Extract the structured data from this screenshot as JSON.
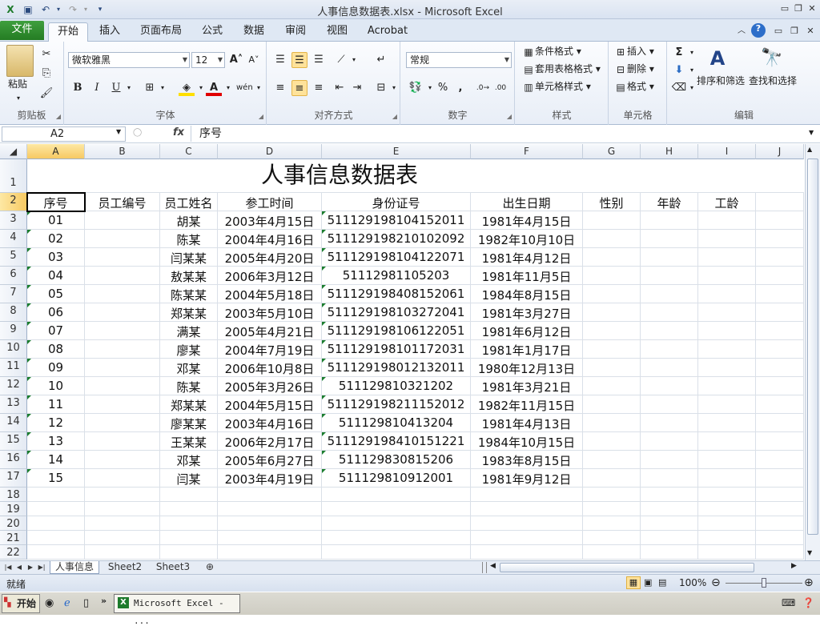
{
  "window": {
    "title": "人事信息数据表.xlsx - Microsoft Excel"
  },
  "ribbon_tabs": [
    "文件",
    "开始",
    "插入",
    "页面布局",
    "公式",
    "数据",
    "审阅",
    "视图",
    "Acrobat"
  ],
  "ribbon": {
    "clipboard": {
      "label": "剪贴板",
      "paste": "粘贴"
    },
    "font": {
      "label": "字体",
      "name": "微软雅黑",
      "size": "12",
      "bold": "B",
      "italic": "I",
      "underline": "U"
    },
    "alignment": {
      "label": "对齐方式"
    },
    "number": {
      "label": "数字",
      "format": "常规",
      "percent": "%",
      "comma": ","
    },
    "styles": {
      "label": "样式",
      "cond_format": "条件格式",
      "table_format": "套用表格格式",
      "cell_styles": "单元格样式"
    },
    "cells": {
      "label": "单元格",
      "insert": "插入",
      "delete": "删除",
      "format": "格式"
    },
    "editing": {
      "label": "编辑",
      "sort_filter": "排序和筛选",
      "find_select": "查找和选择"
    }
  },
  "formula_bar": {
    "name_box": "A2",
    "fx": "fx",
    "value": "序号"
  },
  "columns": [
    "A",
    "B",
    "C",
    "D",
    "E",
    "F",
    "G",
    "H",
    "I",
    "J"
  ],
  "rows": [
    "1",
    "2",
    "3",
    "4",
    "5",
    "6",
    "7",
    "8",
    "9",
    "10",
    "11",
    "12",
    "13",
    "14",
    "15",
    "16",
    "17",
    "18",
    "19",
    "20",
    "21",
    "22"
  ],
  "sheet": {
    "title": "人事信息数据表",
    "headers": [
      "序号",
      "员工编号",
      "员工姓名",
      "参工时间",
      "身份证号",
      "出生日期",
      "性别",
      "年龄",
      "工龄"
    ],
    "records": [
      [
        "01",
        "",
        "胡某",
        "2003年4月15日",
        "511129198104152011",
        "1981年4月15日"
      ],
      [
        "02",
        "",
        "陈某",
        "2004年4月16日",
        "511129198210102092",
        "1982年10月10日"
      ],
      [
        "03",
        "",
        "闫某某",
        "2005年4月20日",
        "511129198104122071",
        "1981年4月12日"
      ],
      [
        "04",
        "",
        "敖某某",
        "2006年3月12日",
        "51112981105203",
        "1981年11月5日"
      ],
      [
        "05",
        "",
        "陈某某",
        "2004年5月18日",
        "511129198408152061",
        "1984年8月15日"
      ],
      [
        "06",
        "",
        "郑某某",
        "2003年5月10日",
        "511129198103272041",
        "1981年3月27日"
      ],
      [
        "07",
        "",
        "满某",
        "2005年4月21日",
        "511129198106122051",
        "1981年6月12日"
      ],
      [
        "08",
        "",
        "廖某",
        "2004年7月19日",
        "511129198101172031",
        "1981年1月17日"
      ],
      [
        "09",
        "",
        "邓某",
        "2006年10月8日",
        "511129198012132011",
        "1980年12月13日"
      ],
      [
        "10",
        "",
        "陈某",
        "2005年3月26日",
        "51112981032120​2",
        "1981年3月21日"
      ],
      [
        "11",
        "",
        "郑某某",
        "2004年5月15日",
        "511129198211152012",
        "1982年11月15日"
      ],
      [
        "12",
        "",
        "廖某某",
        "2003年4月16日",
        "51112981041320​4",
        "1981年4月13日"
      ],
      [
        "13",
        "",
        "王某某",
        "2006年2月17日",
        "511129198410151221",
        "1984年10月15日"
      ],
      [
        "14",
        "",
        "邓某",
        "2005年6月27日",
        "51112983081520​6",
        "1983年8月15日"
      ],
      [
        "15",
        "",
        "闫某",
        "2003年4月19日",
        "511129810912001",
        "1981年9月12日"
      ]
    ]
  },
  "sheet_tabs": [
    "人事信息",
    "Sheet2",
    "Sheet3"
  ],
  "status": {
    "ready": "就绪",
    "zoom": "100%"
  },
  "taskbar": {
    "start": "开始",
    "app": "Microsoft Excel - ..."
  },
  "colors": {
    "file_tab": "#2f8f2e",
    "selection": "#000000",
    "header_selected": "#f7c962"
  }
}
